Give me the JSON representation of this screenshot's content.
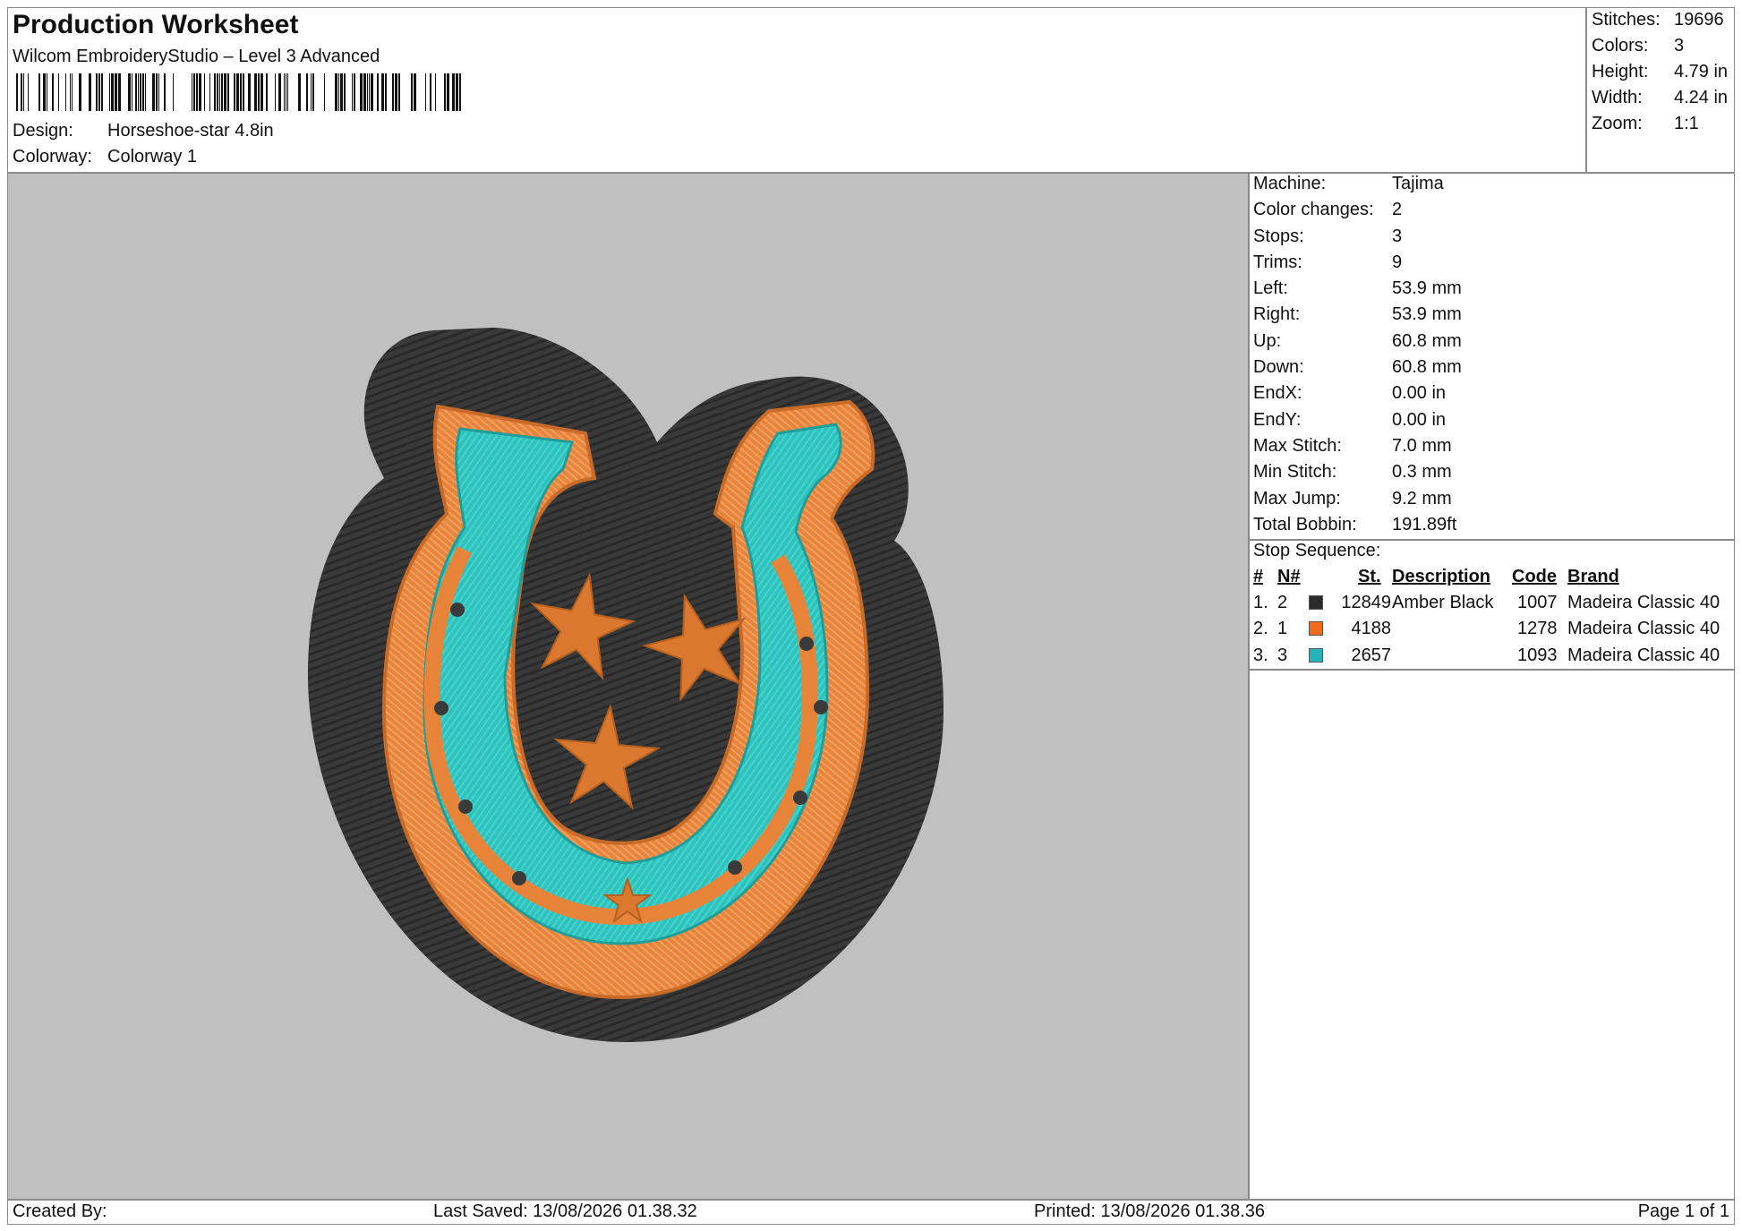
{
  "header": {
    "title": "Production Worksheet",
    "software": "Wilcom EmbroideryStudio – Level 3 Advanced",
    "design_label": "Design:",
    "design_value": "Horseshoe-star 4.8in",
    "colorway_label": "Colorway:",
    "colorway_value": "Colorway 1"
  },
  "summary": [
    {
      "label": "Stitches:",
      "value": "19696"
    },
    {
      "label": "Colors:",
      "value": "3"
    },
    {
      "label": "Height:",
      "value": "4.79 in"
    },
    {
      "label": "Width:",
      "value": "4.24 in"
    },
    {
      "label": "Zoom:",
      "value": "1:1"
    }
  ],
  "machine_info": [
    {
      "label": "Machine:",
      "value": "Tajima"
    },
    {
      "label": "Color changes:",
      "value": "2"
    },
    {
      "label": "Stops:",
      "value": "3"
    },
    {
      "label": "Trims:",
      "value": "9"
    },
    {
      "label": "Left:",
      "value": "53.9 mm"
    },
    {
      "label": "Right:",
      "value": "53.9 mm"
    },
    {
      "label": "Up:",
      "value": "60.8 mm"
    },
    {
      "label": "Down:",
      "value": "60.8 mm"
    },
    {
      "label": "EndX:",
      "value": "0.00 in"
    },
    {
      "label": "EndY:",
      "value": "0.00 in"
    },
    {
      "label": "Max Stitch:",
      "value": "7.0 mm"
    },
    {
      "label": "Min Stitch:",
      "value": "0.3 mm"
    },
    {
      "label": "Max Jump:",
      "value": "9.2 mm"
    },
    {
      "label": "Total Bobbin:",
      "value": "191.89ft"
    }
  ],
  "stop_sequence": {
    "title": "Stop Sequence:",
    "columns": [
      "#",
      "N#",
      "St.",
      "Description",
      "Code",
      "Brand"
    ],
    "rows": [
      {
        "num": "1.",
        "n": "2",
        "color": "#2b2b2b",
        "stitches": "12849",
        "description": "Amber Black",
        "code": "1007",
        "brand": "Madeira Classic 40"
      },
      {
        "num": "2.",
        "n": "1",
        "color": "#f26a1b",
        "stitches": "4188",
        "description": "",
        "code": "1278",
        "brand": "Madeira Classic 40"
      },
      {
        "num": "3.",
        "n": "3",
        "color": "#25b3b8",
        "stitches": "2657",
        "description": "",
        "code": "1093",
        "brand": "Madeira Classic 40"
      }
    ]
  },
  "footer": {
    "created_by": "Created By:",
    "last_saved": "Last Saved: 13/08/2026 01.38.32",
    "printed": "Printed: 13/08/2026 01.38.36",
    "page": "Page 1 of 1"
  },
  "design_colors": {
    "background": "#c0c0c0",
    "fabric": "#3a3a3a",
    "orange": "#e8843a",
    "teal": "#2fc2bd"
  }
}
